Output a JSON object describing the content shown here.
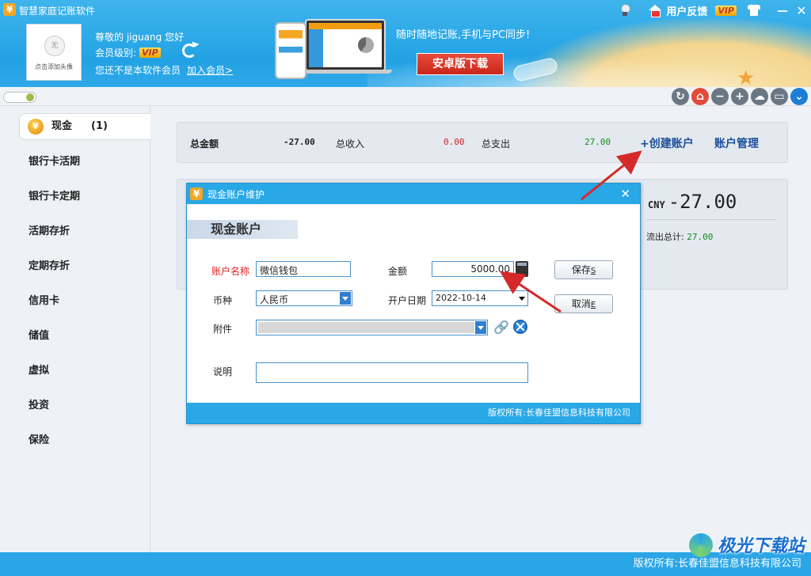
{
  "app": {
    "logo": "¥",
    "title": "智慧家庭记账软件"
  },
  "topbar": {
    "feedback": "用户反馈",
    "vip": "VIP",
    "min": "－",
    "close": "✕"
  },
  "user": {
    "avatar_placeholder": "无",
    "avatar_caption": "点击添加头像",
    "greeting": "尊敬的 jiguang 您好",
    "level_label": "会员级别:",
    "level_badge": "VIP",
    "member_note": "您还不是本软件会员",
    "join_link": "加入会员>"
  },
  "promo": {
    "text": "随时随地记账,手机与PC同步!",
    "android_button": "安卓版下载"
  },
  "toolbar": {
    "icons": [
      "refresh-icon",
      "home-icon",
      "minus-icon",
      "plus-icon",
      "cloud-icon",
      "window-icon",
      "chevron-down-icon"
    ]
  },
  "sidebar": {
    "items": [
      {
        "label": "现金",
        "count": "(1)",
        "active": true
      },
      {
        "label": "银行卡活期"
      },
      {
        "label": "银行卡定期"
      },
      {
        "label": "活期存折"
      },
      {
        "label": "定期存折"
      },
      {
        "label": "信用卡"
      },
      {
        "label": "储值"
      },
      {
        "label": "虚拟"
      },
      {
        "label": "投资"
      },
      {
        "label": "保险"
      }
    ]
  },
  "summary": {
    "total_label": "总金额",
    "total_value": "-27.00",
    "income_label": "总收入",
    "income_value": "0.00",
    "expense_label": "总支出",
    "expense_value": "27.00",
    "create_account": "+创建账户",
    "manage_account": "账户管理"
  },
  "detail": {
    "currency": "CNY",
    "amount": "-27.00",
    "outflow_label": "流出总计:",
    "outflow_value": "27.00"
  },
  "dialog": {
    "logo": "¥",
    "title": "现金账户维护",
    "heading": "现金账户",
    "name_label": "账户名称",
    "name_value": "微信钱包",
    "amount_label": "金额",
    "amount_value": "5000.00",
    "currency_label": "币种",
    "currency_value": "人民币",
    "date_label": "开户日期",
    "date_value": "2022-10-14",
    "attach_label": "附件",
    "note_label": "说明",
    "note_value": "",
    "save_button": "保存",
    "save_key": "S",
    "cancel_button": "取消",
    "cancel_key": "E",
    "footer": "版权所有:长春佳盟信息科技有限公司"
  },
  "statusbar": {
    "copyright": "版权所有:长春佳盟信息科技有限公司"
  },
  "watermark": {
    "text": "极光下载站"
  },
  "colors": {
    "header_blue": "#29a8e6",
    "expense_green": "#1c8a1c",
    "income_red": "#d22222",
    "link_blue": "#1a4f9c",
    "arrow_red": "#d42a2a"
  }
}
